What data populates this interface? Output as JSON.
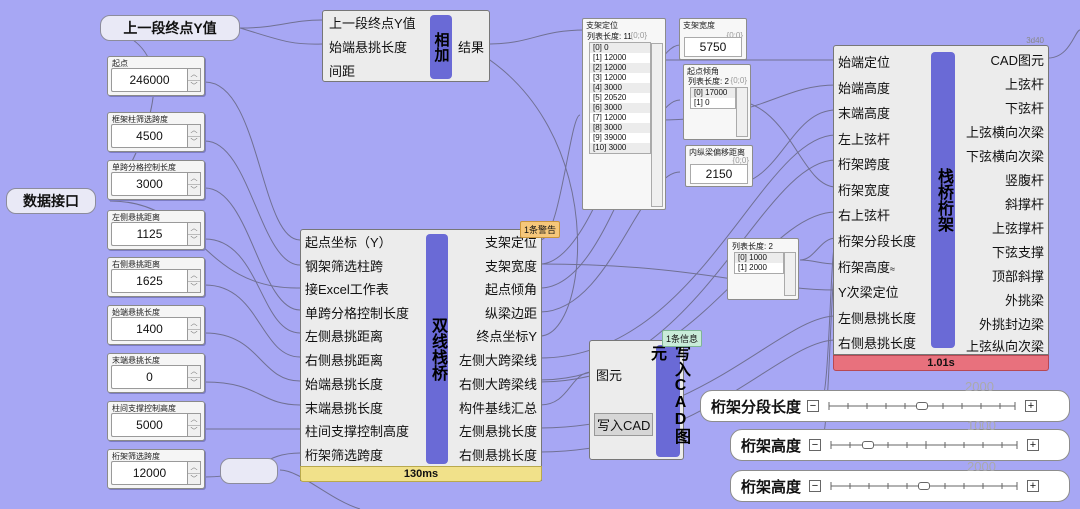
{
  "relays": {
    "prev_y": "上一段终点Y值",
    "data_port": "数据接口"
  },
  "number_boxes": [
    {
      "label": "起点",
      "value": "246000"
    },
    {
      "label": "框架柱筛选跨度",
      "value": "4500"
    },
    {
      "label": "单跨分格控制长度",
      "value": "3000"
    },
    {
      "label": "左侧悬挑距离",
      "value": "1125"
    },
    {
      "label": "右侧悬挑距离",
      "value": "1625"
    },
    {
      "label": "始端悬挑长度",
      "value": "1400"
    },
    {
      "label": "末端悬挑长度",
      "value": "0"
    },
    {
      "label": "柱间支撑控制高度",
      "value": "5000"
    },
    {
      "label": "桁架筛选跨度",
      "value": "12000"
    }
  ],
  "add_component": {
    "inputs": [
      "上一段终点Y值",
      "始端悬挑长度",
      "间距"
    ],
    "name": "相加",
    "outputs": [
      "结果"
    ]
  },
  "bridge_component": {
    "inputs": [
      "起点坐标（Y）",
      "钢架筛选柱跨",
      "接Excel工作表",
      "单跨分格控制长度",
      "左侧悬挑距离",
      "右侧悬挑距离",
      "始端悬挑长度",
      "末端悬挑长度",
      "柱间支撑控制高度",
      "桁架筛选跨度"
    ],
    "name": "双线栈桥",
    "outputs": [
      "支架定位",
      "支架宽度",
      "起点倾角",
      "纵梁边距",
      "终点坐标Y",
      "左侧大跨梁线",
      "右侧大跨梁线",
      "构件基线汇总",
      "左侧悬挑长度",
      "右侧悬挑长度"
    ],
    "time": "130ms",
    "warning": "1条警告"
  },
  "support_pos_panel": {
    "title": "支架定位",
    "header": "列表长度: 11",
    "tag": "{0;0}",
    "items": [
      "[0] 0",
      "[1] 12000",
      "[2] 12000",
      "[3] 12000",
      "[4] 3000",
      "[5] 20520",
      "[6] 3000",
      "[7] 12000",
      "[8] 3000",
      "[9] 39000",
      "[10] 3000"
    ]
  },
  "support_width_panel": {
    "title": "支架宽度",
    "tag": "{0;0}",
    "value": "5750"
  },
  "start_angle_panel": {
    "title": "起点倾角",
    "header": "列表长度: 2",
    "tag": "{0;0}",
    "items": [
      "[0] 17000",
      "[1] 0"
    ]
  },
  "inner_offset_panel": {
    "title": "内纵梁偏移距离",
    "tag": "{0;0}",
    "value": "2150"
  },
  "list_panel": {
    "header": "列表长度: 2",
    "items": [
      "[0] 1000",
      "[1] 2000"
    ]
  },
  "cad_component": {
    "inputs": [
      "图元",
      "写入CAD"
    ],
    "name": "写入CAD图元",
    "info": "1条信息"
  },
  "truss_component": {
    "inputs": [
      "始端定位",
      "始端高度",
      "末端高度",
      "左上弦杆",
      "桁架跨度",
      "桁架宽度",
      "右上弦杆",
      "桁架分段长度",
      "桁架高度",
      "Y次梁定位",
      "左侧悬挑长度",
      "右侧悬挑长度"
    ],
    "name": "栈桥桁架",
    "outputs": [
      "CAD图元",
      "上弦杆",
      "下弦杆",
      "上弦横向次梁",
      "下弦横向次梁",
      "竖腹杆",
      "斜撑杆",
      "上弦撑杆",
      "下弦支撑",
      "顶部斜撑",
      "外挑梁",
      "外挑封边梁",
      "上弦纵向次梁"
    ],
    "time": "1.01s",
    "corner": "3d40",
    "height_marker": "≈"
  },
  "sliders": [
    {
      "name": "桁架分段长度",
      "value": "2000",
      "fraction": 0.5
    },
    {
      "name": "桁架高度",
      "value": "1000",
      "fraction": 0.2
    },
    {
      "name": "桁架高度",
      "value": "2000",
      "fraction": 0.5
    }
  ],
  "colors": {
    "canvas": "#a7a7f4",
    "component_bar": "#6a6ad6",
    "time_ok": "#f1e18a",
    "time_slow": "#e8717d",
    "warning": "#f6c77a",
    "info": "#c9ecd9"
  }
}
